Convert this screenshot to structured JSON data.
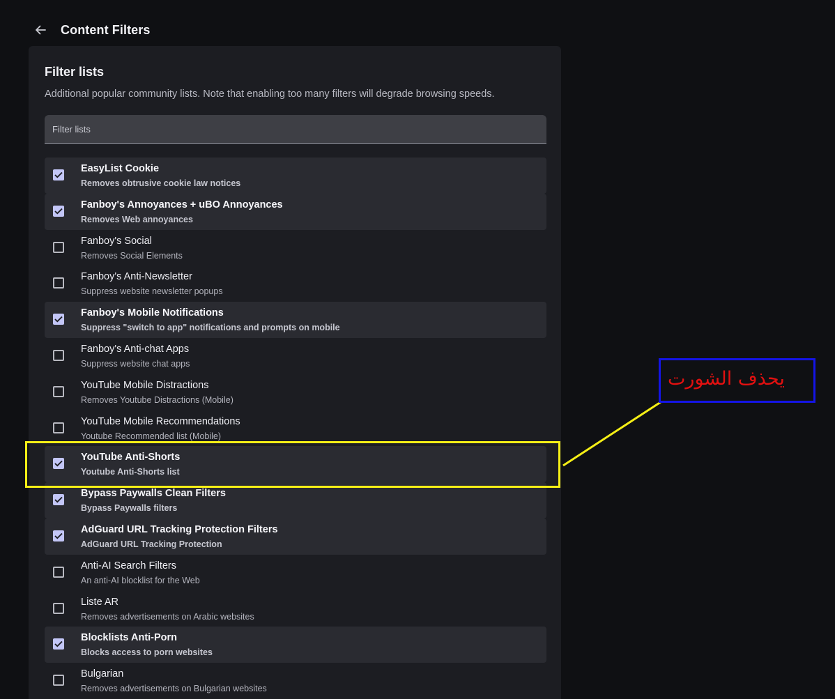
{
  "header": {
    "title": "Content Filters",
    "back_icon": "arrow-left-icon"
  },
  "section": {
    "title": "Filter lists",
    "description": "Additional popular community lists. Note that enabling too many filters will degrade browsing speeds."
  },
  "search": {
    "placeholder": "Filter lists",
    "value": ""
  },
  "filters": [
    {
      "title": "EasyList Cookie",
      "description": "Removes obtrusive cookie law notices",
      "enabled": true
    },
    {
      "title": "Fanboy's Annoyances + uBO Annoyances",
      "description": "Removes Web annoyances",
      "enabled": true
    },
    {
      "title": "Fanboy's Social",
      "description": "Removes Social Elements",
      "enabled": false
    },
    {
      "title": "Fanboy's Anti-Newsletter",
      "description": "Suppress website newsletter popups",
      "enabled": false
    },
    {
      "title": "Fanboy's Mobile Notifications",
      "description": "Suppress \"switch to app\" notifications and prompts on mobile",
      "enabled": true
    },
    {
      "title": "Fanboy's Anti-chat Apps",
      "description": "Suppress website chat apps",
      "enabled": false
    },
    {
      "title": "YouTube Mobile Distractions",
      "description": "Removes Youtube Distractions (Mobile)",
      "enabled": false
    },
    {
      "title": "YouTube Mobile Recommendations",
      "description": "Youtube Recommended list (Mobile)",
      "enabled": false
    },
    {
      "title": "YouTube Anti-Shorts",
      "description": "Youtube Anti-Shorts list",
      "enabled": true
    },
    {
      "title": "Bypass Paywalls Clean Filters",
      "description": "Bypass Paywalls filters",
      "enabled": true
    },
    {
      "title": "AdGuard URL Tracking Protection Filters",
      "description": "AdGuard URL Tracking Protection",
      "enabled": true
    },
    {
      "title": "Anti-AI Search Filters",
      "description": "An anti-AI blocklist for the Web",
      "enabled": false
    },
    {
      "title": "Liste AR",
      "description": "Removes advertisements on Arabic websites",
      "enabled": false
    },
    {
      "title": "Blocklists Anti-Porn",
      "description": "Blocks access to porn websites",
      "enabled": true
    },
    {
      "title": "Bulgarian",
      "description": "Removes advertisements on Bulgarian websites",
      "enabled": false
    }
  ],
  "annotation": {
    "text": "يحذف الشورت",
    "highlight_color": "#f5ef16",
    "box_color": "#1414e6",
    "text_color": "#e21010"
  },
  "colors": {
    "background": "#0f1013",
    "panel": "#1c1d22",
    "checked_row": "#2a2b31",
    "checkbox_accent": "#c3c6f7"
  }
}
